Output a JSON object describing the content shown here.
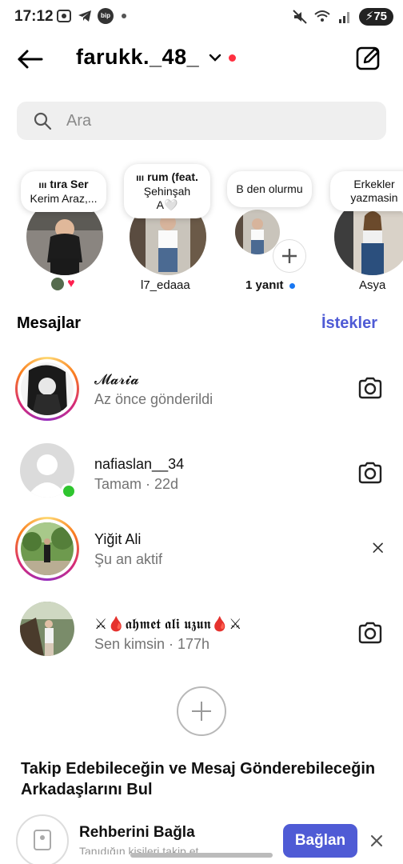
{
  "status_bar": {
    "time": "17:12",
    "battery": "75",
    "bip_label": "bip"
  },
  "header": {
    "username": "farukk._48_"
  },
  "search": {
    "placeholder": "Ara"
  },
  "notes": [
    {
      "note_line1": "tıra      Ser",
      "note_line2": "Kerim Araz,...",
      "label": ""
    },
    {
      "note_line1": "rum (feat.",
      "note_line2": "Şehinşah",
      "note_line3": "A🤍",
      "label": "l7_edaaa"
    },
    {
      "note_line1": "B den olurmu",
      "label": "1 yanıt"
    },
    {
      "note_line1": "Erkekler",
      "note_line2": "yazmasin",
      "label": "Asya"
    }
  ],
  "section": {
    "title": "Mesajlar",
    "requests": "İstekler"
  },
  "messages": [
    {
      "name": "𝓜𝓪𝓻𝓲𝓪",
      "sub": "Az önce gönderildi",
      "action": "camera-icon"
    },
    {
      "name": "nafiaslan__34",
      "sub": "Tamam · 22d",
      "action": "camera-icon"
    },
    {
      "name": "Yiğit Ali",
      "sub": "Şu an aktif",
      "action": "close-icon"
    },
    {
      "name": "⚔🩸𝖆𝖍𝖒𝖊𝖙 𝖆𝖑𝖎 𝖚𝖟𝖚𝖓🩸⚔",
      "sub": "Sen kimsin · 177h",
      "action": "camera-icon"
    }
  ],
  "find": {
    "title": "Takip Edebileceğin ve Mesaj Gönderebileceğin Arkadaşlarını Bul"
  },
  "contacts": {
    "title": "Rehberini Bağla",
    "sub": "Tanıdığın kişileri takip et",
    "button": "Bağlan"
  },
  "colors": {
    "accent": "#4f5bd5",
    "notification": "#ff3040",
    "online": "#2fc52f"
  }
}
